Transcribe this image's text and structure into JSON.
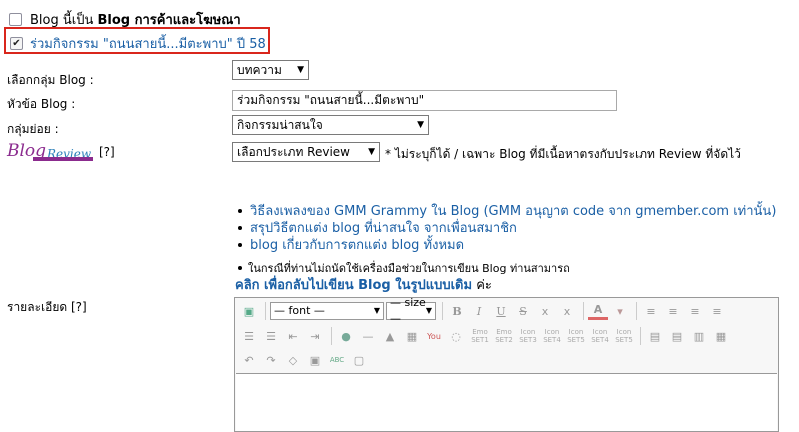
{
  "options": {
    "commercial_blog_label_pre": "Blog นี้เป็น ",
    "commercial_blog_label_bold": "Blog การค้าและโฆษณา",
    "campaign_label": "ร่วมกิจกรรม \"ถนนสายนี้...มีตะพาบ\" ปี 58"
  },
  "form": {
    "group_label": "เลือกกลุ่ม Blog :",
    "group_value": "บทความ",
    "title_label": "หัวข้อ Blog :",
    "title_value": "ร่วมกิจกรรม \"ถนนสายนี้...มีตะพาบ\"",
    "subgroup_label": "กลุ่มย่อย :",
    "subgroup_value": "กิจกรรมน่าสนใจ",
    "review_logo_part1": "Blog",
    "review_logo_part2": "Review",
    "review_help": "[?]",
    "review_select_value": "เลือกประเภท Review",
    "review_note": "* ไม่ระบุก็ได้ / เฉพาะ Blog ที่มีเนื้อหาตรงกับประเภท Review ที่จัดไว้"
  },
  "links": [
    "วิธีลงเพลงของ GMM Grammy ใน Blog (GMM อนุญาต code จาก gmember.com เท่านั้น)",
    "สรุปวิธีตกแต่ง blog ที่น่าสนใจ จากเพื่อนสมาชิก",
    "blog เกี่ยวกับการตกแต่ง blog ทั้งหมด"
  ],
  "notice": {
    "text": "ในกรณีที่ท่านไม่ถนัดใช้เครื่องมือช่วยในการเขียน Blog ท่านสามารถ",
    "link": "คลิก เพื่อกลับไปเขียน Blog ในรูปแบบเดิม",
    "suffix": " ค่ะ"
  },
  "detail": {
    "label": "รายละเอียด [?]"
  },
  "toolbar": {
    "font_value": "— font —",
    "size_value": "— size —",
    "bold": "B",
    "italic": "I",
    "underline": "U",
    "strike": "S",
    "sub": "x",
    "sup": "x",
    "font_color": "A",
    "emo1": "Emo SET1",
    "emo2": "Emo SET2",
    "icon3": "Icon SET3",
    "icon4": "Icon SET4",
    "icon5": "Icon SET5",
    "icon6": "Icon SET4",
    "icon7": "Icon SET5",
    "spell": "ABC"
  },
  "colors": {
    "highlight_border": "#d9261c",
    "link": "#1a5fa5",
    "logo_purple": "#8b2b8e",
    "logo_blue": "#2a7fb8"
  }
}
